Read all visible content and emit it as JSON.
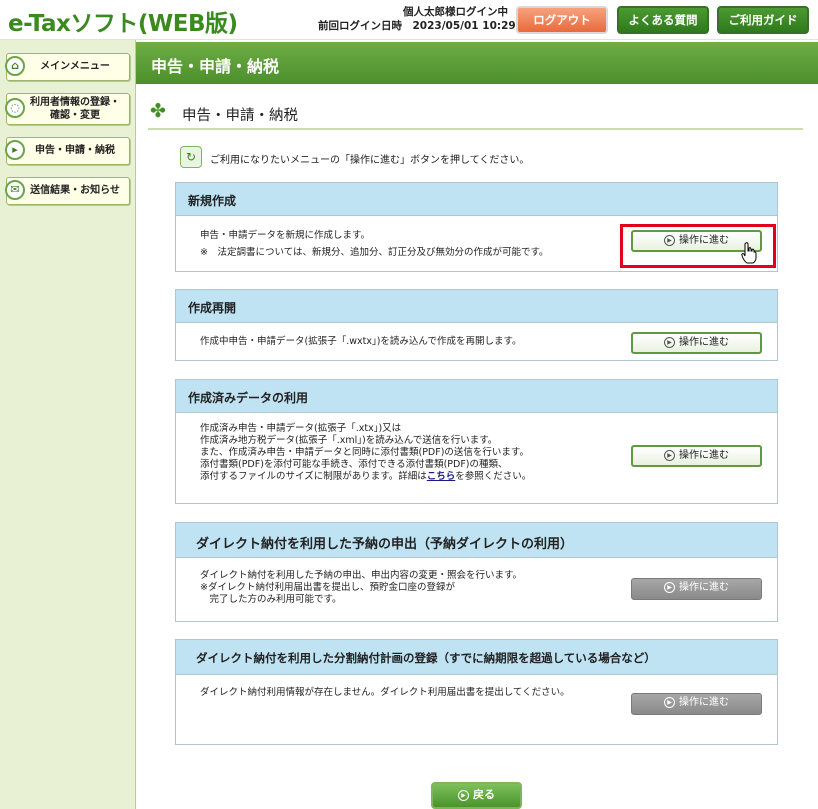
{
  "header": {
    "logo": "e-Taxソフト(WEB版)",
    "user_status": "個人太郎様ログイン中",
    "last_login": "前回ログイン日時　2023/05/01 10:29",
    "logout_label": "ログアウト",
    "faq_label": "よくある質問",
    "guide_label": "ご利用ガイド"
  },
  "sidebar": {
    "items": [
      {
        "label": "メインメニュー",
        "icon": "home-icon"
      },
      {
        "label": "利用者情報の登録・確認・変更",
        "label_line1": "利用者情報の登録・",
        "label_line2": "確認・変更",
        "icon": "user-icon"
      },
      {
        "label": "申告・申請・納税",
        "icon": "declaration-icon"
      },
      {
        "label": "送信結果・お知らせ",
        "icon": "notice-icon"
      }
    ]
  },
  "main": {
    "band_title": "申告・申請・納税",
    "page_title": "申告・申請・納税",
    "intro": "ご利用になりたいメニューの「操作に進む」ボタンを押してください。"
  },
  "panels": [
    {
      "title": "新規作成",
      "desc": [
        "申告・申請データを新規に作成します。",
        "※　法定調書については、新規分、追加分、訂正分及び無効分の作成が可能です。"
      ],
      "button": "操作に進む",
      "enabled": true
    },
    {
      "title": "作成再開",
      "desc": [
        "作成中申告・申請データ(拡張子「.wxtx」)を読み込んで作成を再開します。"
      ],
      "button": "操作に進む",
      "enabled": true
    },
    {
      "title": "作成済みデータの利用",
      "desc": [
        "作成済み申告・申請データ(拡張子「.xtx」)又は",
        "作成済み地方税データ(拡張子「.xml」)を読み込んで送信を行います。",
        "また、作成済み申告・申請データと同時に添付書類(PDF)の送信を行います。",
        "添付書類(PDF)を添付可能な手続き、添付できる添付書類(PDF)の種類、",
        "添付するファイルのサイズに制限があります。詳細は"
      ],
      "link": "こちら",
      "desc_tail": "を参照ください。",
      "button": "操作に進む",
      "enabled": true
    },
    {
      "title": "ダイレクト納付を利用した予納の申出（予納ダイレクトの利用）",
      "desc": [
        "ダイレクト納付を利用した予納の申出、申出内容の変更・照会を行います。",
        "※ダイレクト納付利用届出書を提出し、預貯金口座の登録が",
        "　完了した方のみ利用可能です。"
      ],
      "button": "操作に進む",
      "enabled": false
    },
    {
      "title": "ダイレクト納付を利用した分割納付計画の登録（すでに納期限を超過している場合など）",
      "desc": [
        "ダイレクト納付利用情報が存在しません。ダイレクト利用届出書を提出してください。"
      ],
      "button": "操作に進む",
      "enabled": false
    }
  ],
  "back_label": "戻る",
  "colors": {
    "brand_green": "#4b8f2c",
    "panel_header": "#bfe3f3",
    "highlight": "#e3001b",
    "logout": "#e86a3c"
  }
}
